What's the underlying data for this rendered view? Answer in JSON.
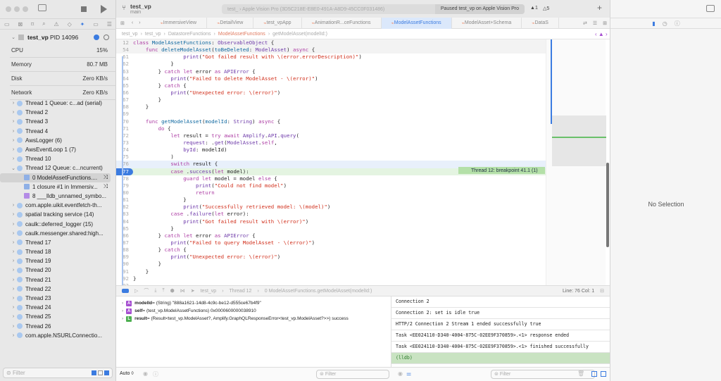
{
  "window": {
    "project": "test_vp",
    "branch": "main",
    "scheme_path": "test_  ›  Apple Vision Pro (3D5C218E-E8E0-491A-A8D9-45CC0F031486)",
    "status": "Paused test_vp on Apple Vision Pro",
    "errors": "1",
    "warnings": "5"
  },
  "tabs": [
    "ImmersiveView",
    "DetailView",
    "test_vpApp",
    "AnimationR...ceFunctions",
    "ModelAssetFunctions",
    "ModelAsset+Schema",
    "DataS"
  ],
  "active_tab": 4,
  "breadcrumb": [
    "test_vp",
    "test_vp",
    "DatastoreFunctions",
    "ModelAssetFunctions",
    "getModelAsset(modelId:)"
  ],
  "process": {
    "name": "test_vp",
    "pid": "PID 14096",
    "gauges": [
      {
        "label": "CPU",
        "value": "15%"
      },
      {
        "label": "Memory",
        "value": "80.7 MB"
      },
      {
        "label": "Disk",
        "value": "Zero KB/s"
      },
      {
        "label": "Network",
        "value": "Zero KB/s"
      }
    ]
  },
  "threads": [
    {
      "label": "Thread 1 Queue: c...ad (serial)",
      "kind": "thread",
      "open": false
    },
    {
      "label": "Thread 2",
      "kind": "thread"
    },
    {
      "label": "Thread 3",
      "kind": "thread"
    },
    {
      "label": "Thread 4",
      "kind": "thread"
    },
    {
      "label": "AwsLogger (6)",
      "kind": "thread"
    },
    {
      "label": "AwsEventLoop 1 (7)",
      "kind": "thread"
    },
    {
      "label": "Thread 10",
      "kind": "thread"
    },
    {
      "label": "Thread 12 Queue: c...ncurrent)",
      "kind": "thread",
      "open": true
    },
    {
      "label": "0 ModelAssetFunctions....",
      "kind": "frame",
      "selected": true
    },
    {
      "label": "1 closure #1 in Immersiv...",
      "kind": "frame"
    },
    {
      "label": "8 ___lldb_unnamed_symbo...",
      "kind": "frame2"
    },
    {
      "label": "com.apple.uikit.eventfetch-th...",
      "kind": "thread"
    },
    {
      "label": "spatial tracking service (14)",
      "kind": "thread"
    },
    {
      "label": "caulk::deferred_logger (15)",
      "kind": "thread"
    },
    {
      "label": "caulk.messenger.shared:high...",
      "kind": "thread"
    },
    {
      "label": "Thread 17",
      "kind": "thread"
    },
    {
      "label": "Thread 18",
      "kind": "thread"
    },
    {
      "label": "Thread 19",
      "kind": "thread"
    },
    {
      "label": "Thread 20",
      "kind": "thread"
    },
    {
      "label": "Thread 21",
      "kind": "thread"
    },
    {
      "label": "Thread 22",
      "kind": "thread"
    },
    {
      "label": "Thread 23",
      "kind": "thread"
    },
    {
      "label": "Thread 24",
      "kind": "thread"
    },
    {
      "label": "Thread 25",
      "kind": "thread"
    },
    {
      "label": "Thread 26",
      "kind": "thread"
    },
    {
      "label": "com.apple.NSURLConnectio...",
      "kind": "thread"
    }
  ],
  "sidebar_filter_placeholder": "Filter",
  "code": [
    {
      "n": "12",
      "text": "class ModelAssetFunctions: ObservableObject {",
      "sticky": true
    },
    {
      "n": "54",
      "text": "    func deleteModelAsset(toBeDeleted: ModelAsset) async {",
      "sticky": true
    },
    {
      "n": "61",
      "text": "                print(\"Got failed result with \\(error.errorDescription)\")"
    },
    {
      "n": "62",
      "text": "            }"
    },
    {
      "n": "63",
      "text": "        } catch let error as APIError {"
    },
    {
      "n": "64",
      "text": "            print(\"Failed to delete ModelAsset - \\(error)\")"
    },
    {
      "n": "65",
      "text": "        } catch {"
    },
    {
      "n": "66",
      "text": "            print(\"Unexpected error: \\(error)\")"
    },
    {
      "n": "67",
      "text": "        }"
    },
    {
      "n": "68",
      "text": "    }"
    },
    {
      "n": "69",
      "text": ""
    },
    {
      "n": "70",
      "text": "    func getModelAsset(modelId: String) async {"
    },
    {
      "n": "71",
      "text": "        do {"
    },
    {
      "n": "72",
      "text": "            let result = try await Amplify.API.query("
    },
    {
      "n": "73",
      "text": "                request: .get(ModelAsset.self,"
    },
    {
      "n": "74",
      "text": "                byId: modelId)"
    },
    {
      "n": "75",
      "text": "            )"
    },
    {
      "n": "76",
      "text": "            switch result {",
      "current": true
    },
    {
      "n": "77",
      "text": "            case .success(let model):",
      "breakpoint": true
    },
    {
      "n": "78",
      "text": "                guard let model = model else {"
    },
    {
      "n": "79",
      "text": "                    print(\"Could not find model\")"
    },
    {
      "n": "80",
      "text": "                    return"
    },
    {
      "n": "81",
      "text": "                }"
    },
    {
      "n": "82",
      "text": "                print(\"Successfully retrieved model: \\(model)\")"
    },
    {
      "n": "83",
      "text": "            case .failure(let error):"
    },
    {
      "n": "84",
      "text": "                print(\"Got failed result with \\(error)\")"
    },
    {
      "n": "85",
      "text": "            }"
    },
    {
      "n": "86",
      "text": "        } catch let error as APIError {"
    },
    {
      "n": "87",
      "text": "            print(\"Failed to query ModelAsset - \\(error)\")"
    },
    {
      "n": "88",
      "text": "        } catch {"
    },
    {
      "n": "89",
      "text": "            print(\"Unexpected error: \\(error)\")"
    },
    {
      "n": "90",
      "text": "        }"
    },
    {
      "n": "91",
      "text": "    }"
    },
    {
      "n": "92",
      "text": "}"
    },
    {
      "n": "93",
      "text": ""
    }
  ],
  "breakpoint_label": "Thread 12: breakpoint 41.1 (1)",
  "debug_path": [
    "test_vp",
    "Thread 12",
    "0 ModelAssetFunctions.getModelAsset(modelId:)"
  ],
  "cursor": "Line: 76  Col: 1",
  "variables": [
    {
      "badge": "A",
      "color": "#a64fd1",
      "name": "modelId",
      "value": " = (String) \"888a1621-14d8-4c9c-be12-d555ce67b4f9\""
    },
    {
      "badge": "A",
      "color": "#a64fd1",
      "name": "self",
      "value": " = (test_vp.ModelAssetFunctions) 0x0000600000038910"
    },
    {
      "badge": "L",
      "color": "#4caf50",
      "name": "result",
      "value": " = (Result<test_vp.ModelAsset?, Amplify.GraphQLResponseError<test_vp.ModelAsset?>>) success"
    }
  ],
  "console": [
    "Connection 2",
    "Connection 2: set is idle true",
    "HTTP/2 Connection 2 Stream 1 ended successfully true",
    "Task <EE024110-D340-4004-875C-02EE9F370859>.<1> response ended",
    "Task <EE024110-D340-4004-875C-02EE9F370859>.<1> finished successfully"
  ],
  "console_prompt": "(lldb)",
  "vars_scope": "Auto ◊",
  "vars_filter_placeholder": "Filter",
  "console_filter_placeholder": "Filter",
  "inspector": {
    "empty": "No Selection"
  }
}
